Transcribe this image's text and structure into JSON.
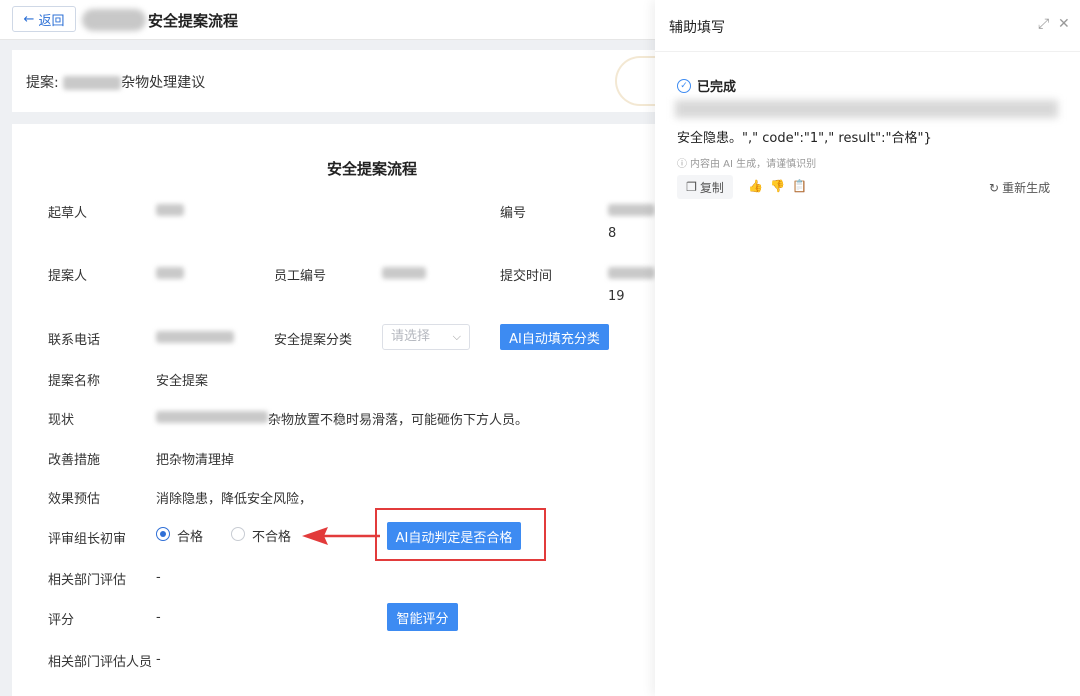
{
  "topbar": {
    "back_label": "返回",
    "title": "安全提案流程"
  },
  "proposal": {
    "prefix": "提案:",
    "name_suffix": "杂物处理建议"
  },
  "form": {
    "title": "安全提案流程",
    "fields": {
      "drafter_label": "起草人",
      "number_label": "编号",
      "number_suffix": "8",
      "proposer_label": "提案人",
      "employee_no_label": "员工编号",
      "submit_time_label": "提交时间",
      "submit_time_suffix": "19",
      "phone_label": "联系电话",
      "category_label": "安全提案分类",
      "category_placeholder": "请选择",
      "ai_fill_category": "AI自动填充分类",
      "proposal_name_label": "提案名称",
      "proposal_name_value": "安全提案",
      "status_label": "现状",
      "status_value": "杂物放置不稳时易滑落，可能砸伤下方人员。",
      "improve_label": "改善措施",
      "improve_value": "把杂物清理掉",
      "effect_label": "效果预估",
      "effect_value": "消除隐患，降低安全风险，",
      "review_label": "评审组长初审",
      "pass_label": "合格",
      "fail_label": "不合格",
      "ai_judge": "AI自动判定是否合格",
      "dept_eval_label": "相关部门评估",
      "dept_eval_value": "-",
      "score_label": "评分",
      "score_value": "-",
      "smart_score": "智能评分",
      "dept_person_label": "相关部门评估人员",
      "dept_person_value": "-"
    },
    "selected_review": "合格"
  },
  "assistant": {
    "title": "辅助填写",
    "status": "已完成",
    "result_text": "安全隐患。\",\"   code\":\"1\",\"   result\":\"合格\"}",
    "ai_note": "内容由 AI 生成，请谨慎识别",
    "copy_label": "复制",
    "regenerate_label": "重新生成"
  },
  "colors": {
    "primary": "#3d8bf2",
    "highlight": "#e23b3b"
  }
}
